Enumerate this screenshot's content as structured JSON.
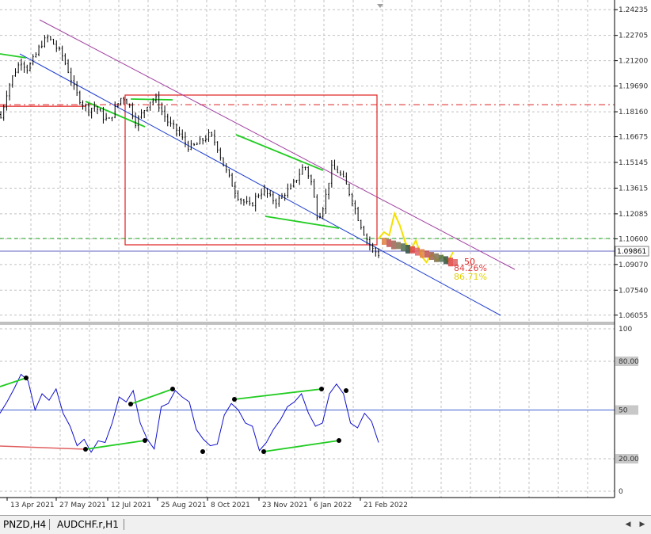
{
  "colors": {
    "background": "#ffffff",
    "grid": "#c0c0c0",
    "candle": "#000000",
    "channel_upper": "#a040a0",
    "channel_lower": "#2040d0",
    "divergence": "#22cc22",
    "box": "#e02020",
    "resistance_dashed": "#e02020",
    "support_dashed": "#22bb22",
    "rsi_line": "#1010cc",
    "forecast": "#f5e000"
  },
  "price_axis": {
    "labels": [
      "1.24235",
      "1.22705",
      "1.21200",
      "1.19690",
      "1.18160",
      "1.16675",
      "1.15145",
      "1.13615",
      "1.12085",
      "1.10600",
      "1.09070",
      "1.07540",
      "1.06055"
    ],
    "min": 1.05855,
    "max": 1.24435,
    "current_price": "1.09861"
  },
  "rsi_axis": {
    "labels": [
      "100",
      "80.00",
      "50",
      "20.00",
      "0"
    ],
    "level_labels": [
      "80.00",
      "50",
      "20.00"
    ]
  },
  "time_axis": {
    "labels": [
      "13 Apr 2021",
      "27 May 2021",
      "12 Jul 2021",
      "25 Aug 2021",
      "8 Oct 2021",
      "23 Nov 2021",
      "6 Jan 2022",
      "21 Feb 2022"
    ]
  },
  "annotations": {
    "level": "50",
    "pct1": "84.26%",
    "pct2": "86.71%"
  },
  "tabs": [
    "PNZD,H4",
    "AUDCHF.r,H1"
  ],
  "chart_data": [
    {
      "type": "candlestick",
      "title": "",
      "ylim": [
        1.05855,
        1.24435
      ],
      "x": [
        "13 Apr 2021",
        "27 May 2021",
        "12 Jul 2021",
        "25 Aug 2021",
        "8 Oct 2021",
        "23 Nov 2021",
        "6 Jan 2022",
        "21 Feb 2022"
      ],
      "series": [
        {
          "close_path": [
            1.178,
            1.195,
            1.205,
            1.212,
            1.207,
            1.214,
            1.222,
            1.226,
            1.221,
            1.216,
            1.206,
            1.194,
            1.187,
            1.183,
            1.185,
            1.179,
            1.176,
            1.184,
            1.191,
            1.186,
            1.175,
            1.181,
            1.188,
            1.189,
            1.181,
            1.174,
            1.171,
            1.165,
            1.16,
            1.162,
            1.165,
            1.168,
            1.162,
            1.15,
            1.141,
            1.132,
            1.128,
            1.125,
            1.132,
            1.135,
            1.13,
            1.128,
            1.133,
            1.136,
            1.143,
            1.15,
            1.14,
            1.118,
            1.128,
            1.148,
            1.146,
            1.14,
            1.13,
            1.118,
            1.108,
            1.1,
            1.097
          ]
        }
      ],
      "forecast": [
        1.106,
        1.11,
        1.108,
        1.121,
        1.114,
        1.104,
        1.099,
        1.105,
        1.096,
        1.092,
        1.097,
        1.093,
        1.096,
        1.092,
        1.098
      ],
      "levels": {
        "resistance": 1.1858,
        "support": 1.1062,
        "current": 1.09861
      }
    },
    {
      "type": "line",
      "title": "",
      "ylim": [
        0,
        100
      ],
      "levels": [
        80,
        50,
        20
      ],
      "series": [
        {
          "values": [
            48,
            55,
            63,
            72,
            68,
            50,
            60,
            56,
            63,
            48,
            40,
            28,
            32,
            24,
            31,
            30,
            42,
            58,
            55,
            62,
            42,
            32,
            26,
            52,
            54,
            62,
            58,
            55,
            38,
            32,
            28,
            29,
            47,
            54,
            50,
            42,
            40,
            25,
            30,
            38,
            44,
            52,
            55,
            60,
            48,
            40,
            42,
            60,
            66,
            60,
            42,
            39,
            48,
            43,
            30
          ]
        }
      ]
    }
  ]
}
